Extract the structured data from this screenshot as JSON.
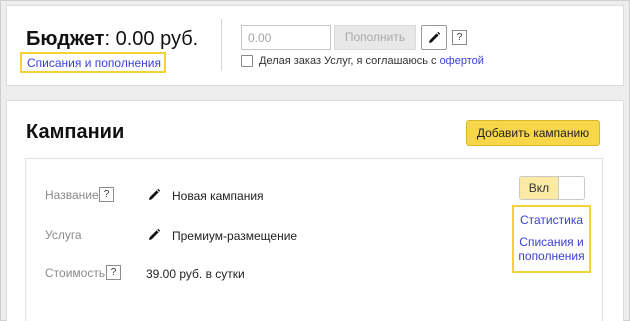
{
  "budget": {
    "label": "Бюджет",
    "amount": ": 0.00 руб.",
    "history_link": "Списания и пополнения",
    "amount_placeholder": "0.00",
    "topup_button": "Пополнить",
    "help": "?",
    "offer_text": "Делая заказ Услуг, я соглашаюсь с",
    "offer_link": "офертой"
  },
  "campaigns": {
    "title": "Кампании",
    "add_button": "Добавить кампанию",
    "item": {
      "name_label": "Название",
      "name_help": "?",
      "name_value": "Новая кампания",
      "service_label": "Услуга",
      "service_value": "Премиум-размещение",
      "cost_label": "Стоимость",
      "cost_help": "?",
      "cost_value": "39.00 руб. в сутки",
      "toggle_label": "Вкл",
      "stats_link": "Статистика",
      "history_link_line1": "Списания и",
      "history_link_line2": "пополнения"
    }
  },
  "colors": {
    "accent_yellow": "#f7d64a",
    "highlight_border": "#f2d237",
    "link": "#3a3fd6"
  }
}
